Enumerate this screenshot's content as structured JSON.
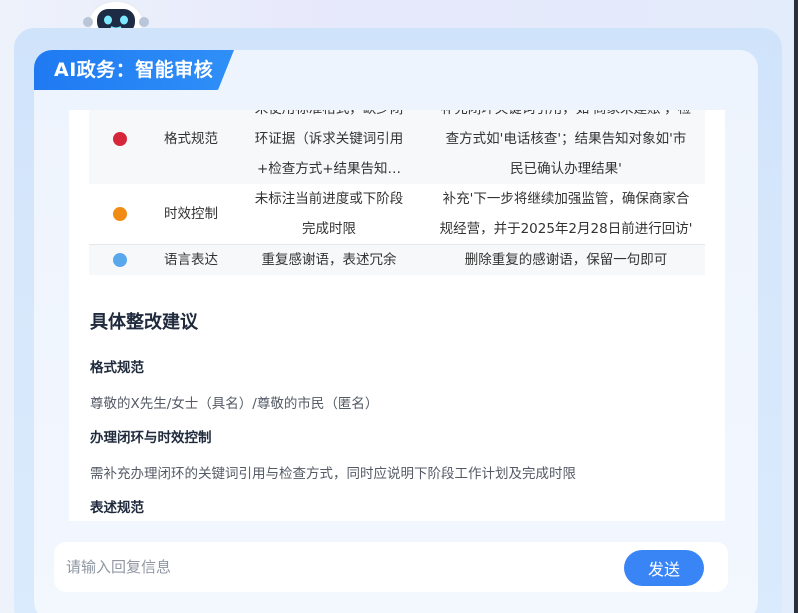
{
  "header": {
    "title": "AI政务：智能审核"
  },
  "issues_table": {
    "rows": [
      {
        "color": "#d5263a",
        "type": "格式规范",
        "desc_lines": [
          "未使用标准格式，缺少闭",
          "环证据（诉求关键词引用",
          "+检查方式+结果告知…"
        ],
        "fix_lines": [
          "补充闭环关键词引用，如'商家未建账'，检",
          "查方式如'电话核查'；结果告知对象如'市",
          "民已确认办理结果'"
        ]
      },
      {
        "color": "#f08c16",
        "type": "时效控制",
        "desc_lines": [
          "未标注当前进度或下阶段",
          "完成时限"
        ],
        "fix_lines": [
          "补充'下一步将继续加强监管，确保商家合",
          "规经营，并于2025年2月28日前进行回访'"
        ]
      },
      {
        "color": "#5aa8ec",
        "type": "语言表达",
        "desc_lines": [
          "重复感谢语，表述冗余"
        ],
        "fix_lines": [
          "删除重复的感谢语，保留一句即可"
        ]
      }
    ]
  },
  "suggestions": {
    "title": "具体整改建议",
    "items": [
      {
        "heading": "格式规范",
        "text": "尊敬的X先生/女士（具名）/尊敬的市民（匿名）"
      },
      {
        "heading": "办理闭环与时效控制",
        "text": "需补充办理闭环的关键词引用与检查方式，同时应说明下阶段工作计划及完成时限"
      },
      {
        "heading": "表述规范",
        "text": ""
      }
    ]
  },
  "input": {
    "placeholder": "请输入回复信息",
    "value": ""
  },
  "send_button": {
    "label": "发送"
  },
  "icons": {
    "mascot": "robot-mascot-icon"
  }
}
